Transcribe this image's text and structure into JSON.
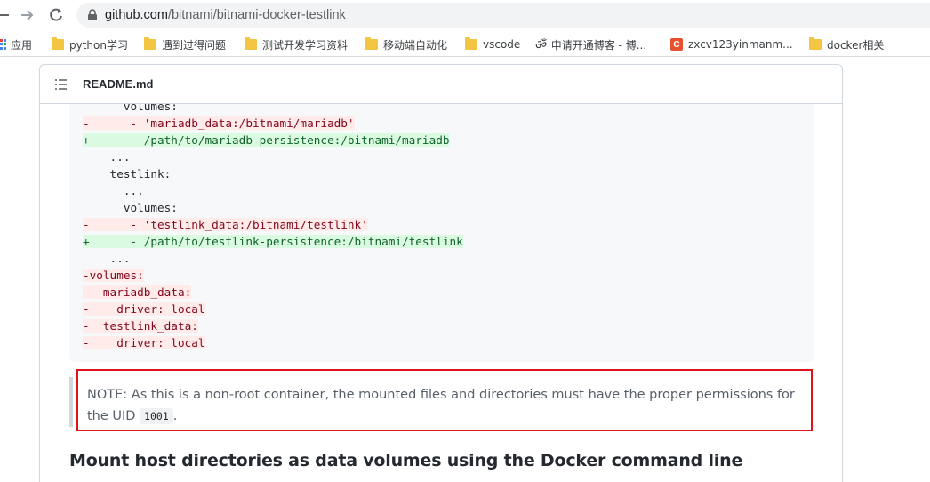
{
  "browser": {
    "url_host": "github.com",
    "url_path": "/bitnami/bitnami-docker-testlink"
  },
  "bookmarks": [
    {
      "label": "应用",
      "icon": "apps-grid-icon"
    },
    {
      "label": "python学习",
      "icon": "folder-icon"
    },
    {
      "label": "遇到过得问题",
      "icon": "folder-icon"
    },
    {
      "label": "测试开发学习资料",
      "icon": "folder-icon"
    },
    {
      "label": "移动端自动化",
      "icon": "folder-icon"
    },
    {
      "label": "vscode",
      "icon": "folder-icon"
    },
    {
      "label": "申请开通博客 - 博...",
      "icon": "script-logo-icon"
    },
    {
      "label": "zxcv123yinmanm...",
      "icon": "csdn-c-icon"
    },
    {
      "label": "docker相关",
      "icon": "folder-icon"
    }
  ],
  "readme": {
    "title": "README.md",
    "code_lines": [
      {
        "type": "ctx",
        "text": "      volumes:"
      },
      {
        "type": "del",
        "text": "-      - 'mariadb_data:/bitnami/mariadb'"
      },
      {
        "type": "add",
        "text": "+      - /path/to/mariadb-persistence:/bitnami/mariadb"
      },
      {
        "type": "ctx",
        "text": "    ..."
      },
      {
        "type": "ctx",
        "text": "    testlink:"
      },
      {
        "type": "ctx",
        "text": "      ..."
      },
      {
        "type": "ctx",
        "text": "      volumes:"
      },
      {
        "type": "del",
        "text": "-      - 'testlink_data:/bitnami/testlink'"
      },
      {
        "type": "add",
        "text": "+      - /path/to/testlink-persistence:/bitnami/testlink"
      },
      {
        "type": "ctx",
        "text": "    ..."
      },
      {
        "type": "del",
        "text": "-volumes:"
      },
      {
        "type": "del",
        "text": "-  mariadb_data:"
      },
      {
        "type": "del",
        "text": "-    driver: local"
      },
      {
        "type": "del",
        "text": "-  testlink_data:"
      },
      {
        "type": "del",
        "text": "-    driver: local"
      }
    ],
    "note": {
      "text_before": "NOTE: As this is a non-root container, the mounted files and directories must have the proper permissions for the UID ",
      "code": "1001",
      "text_after": "."
    },
    "heading": "Mount host directories as data volumes using the Docker command line"
  },
  "colors": {
    "highlight_frame": "#e0121b",
    "del_bg": "#ffebe9",
    "add_bg": "#dafbe1"
  }
}
